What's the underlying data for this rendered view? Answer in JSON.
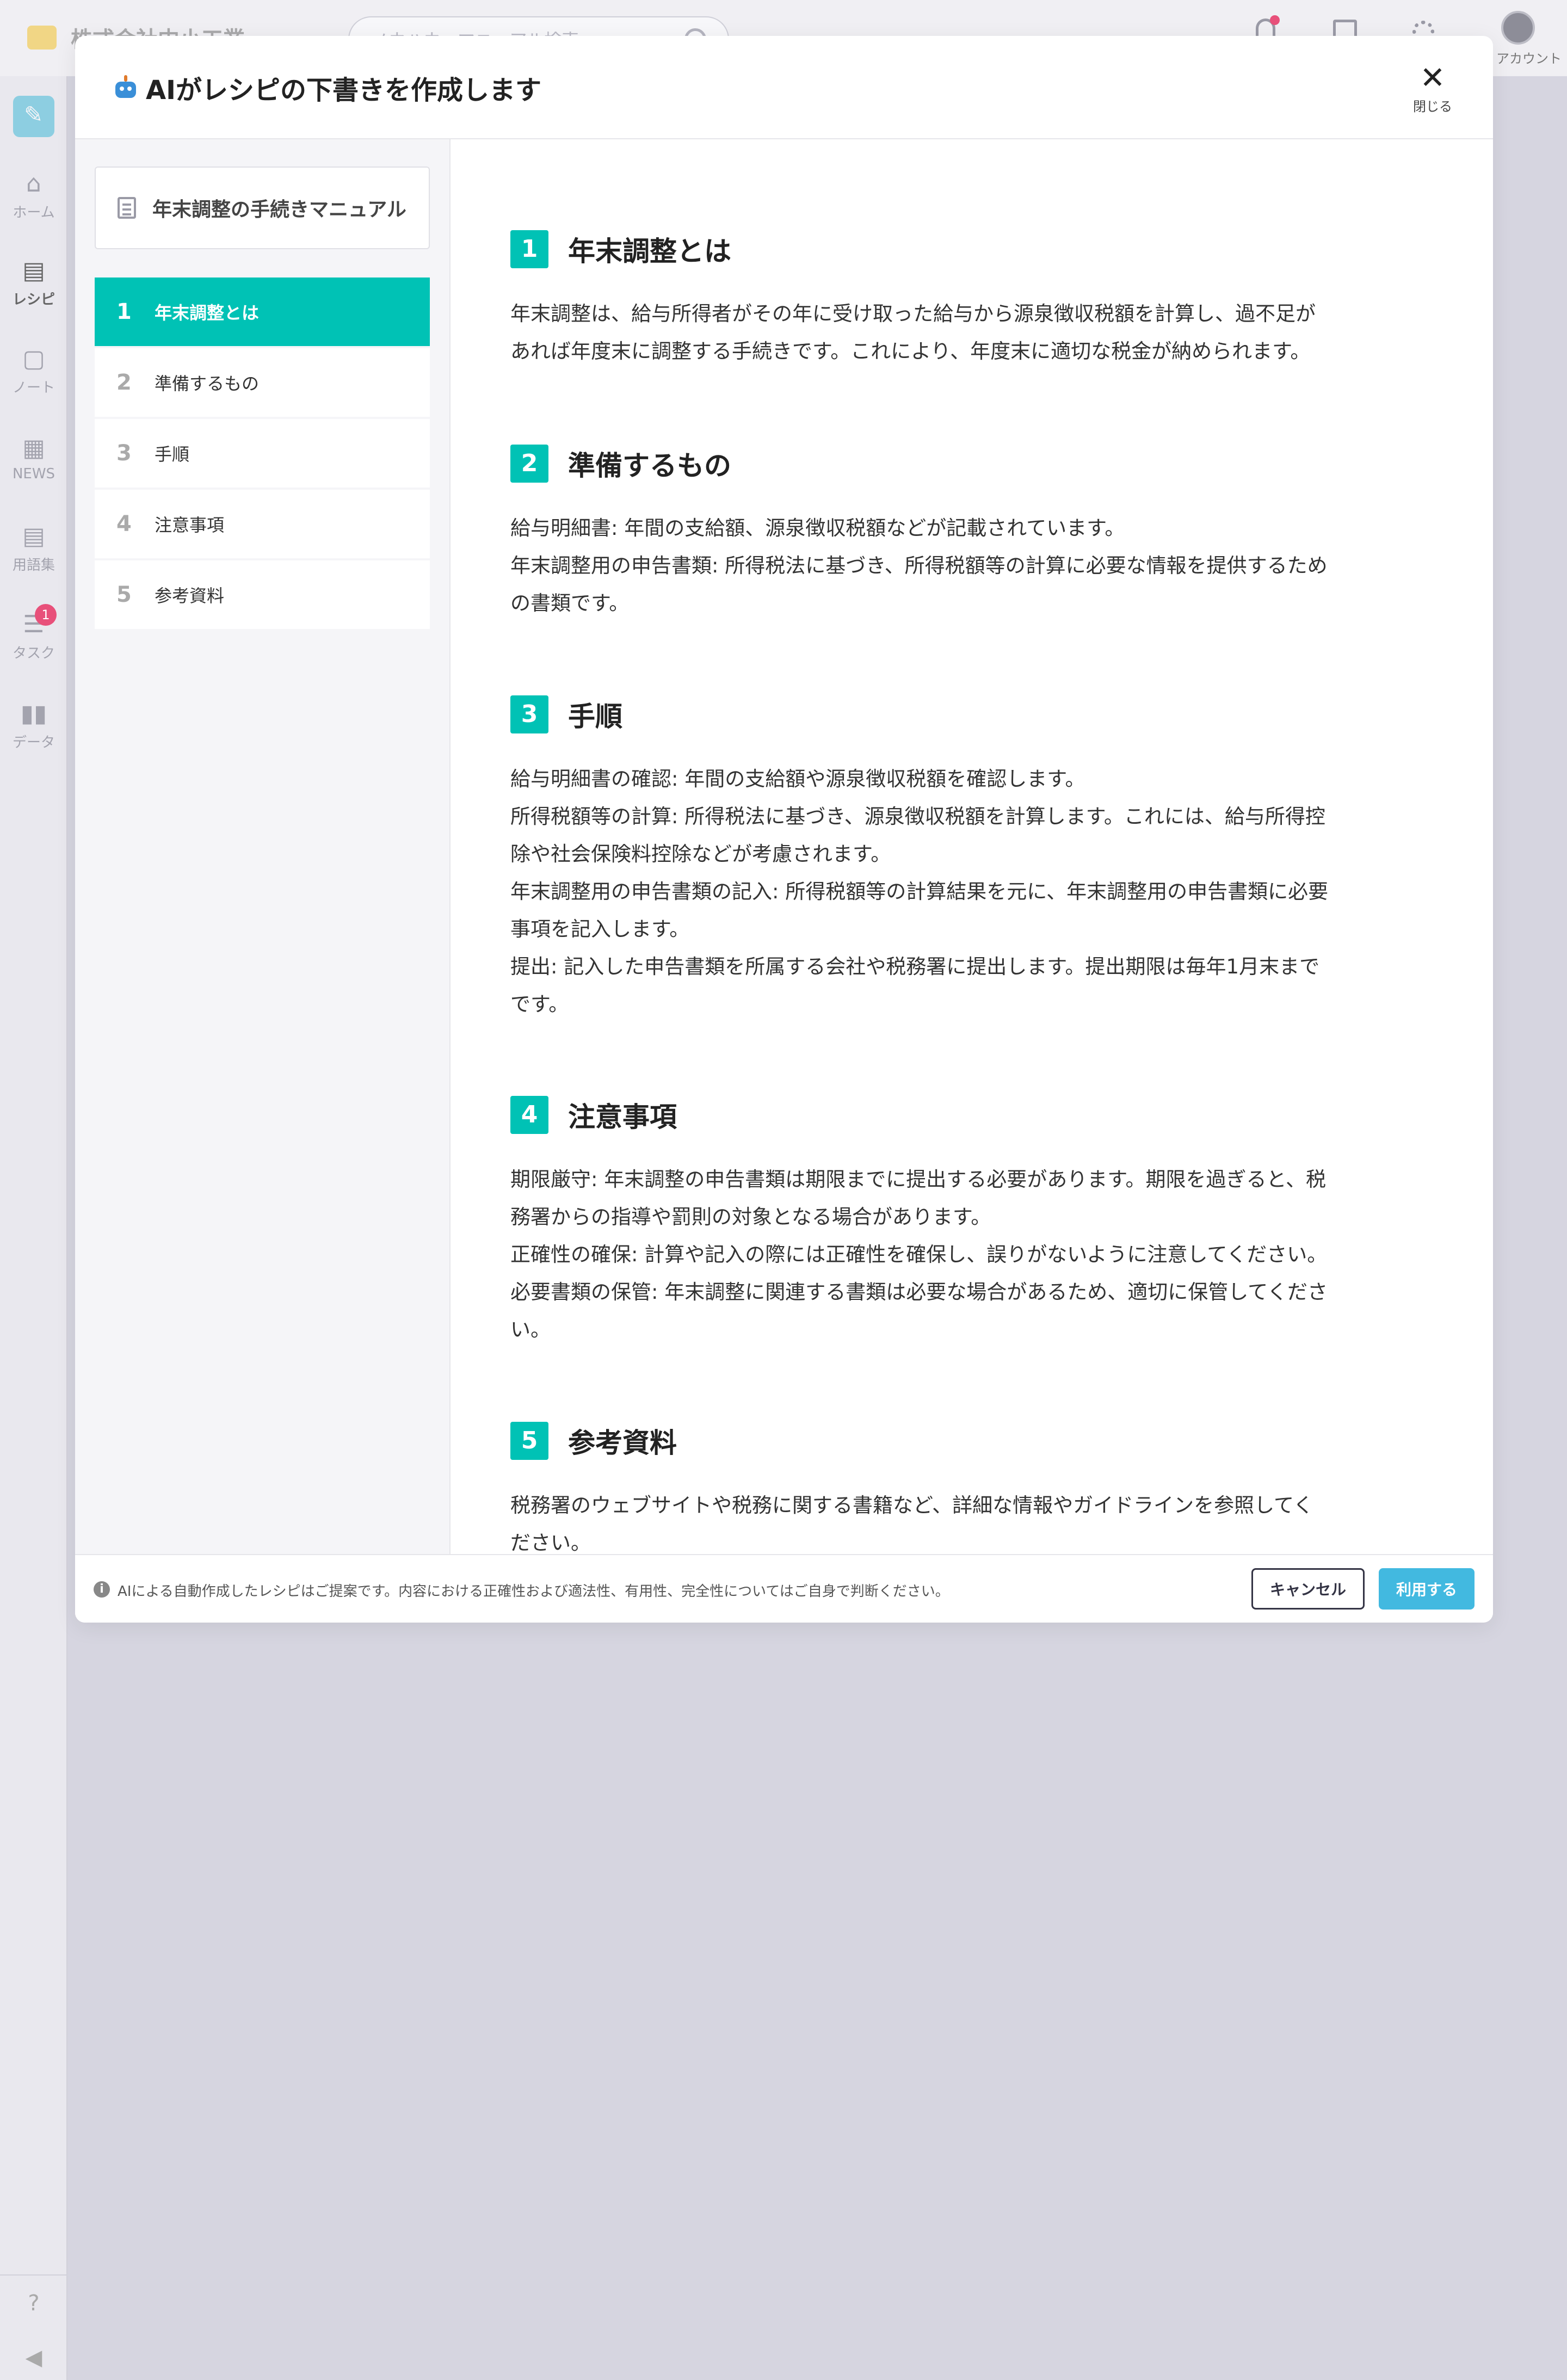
{
  "app": {
    "company": "株式会社中小工業",
    "search_placeholder": "ノウハウ、マニュアル検索",
    "account_label": "アカウント"
  },
  "sidebar": {
    "items": [
      {
        "icon": "home-icon",
        "label": "ホーム"
      },
      {
        "icon": "recipe-icon",
        "label": "レシピ"
      },
      {
        "icon": "note-icon",
        "label": "ノート"
      },
      {
        "icon": "news-icon",
        "label": "NEWS"
      },
      {
        "icon": "glossary-icon",
        "label": "用語集"
      },
      {
        "icon": "task-icon",
        "label": "タスク",
        "badge": "1"
      },
      {
        "icon": "data-icon",
        "label": "データ"
      }
    ]
  },
  "modal": {
    "title": "AIがレシピの下書きを作成します",
    "close_label": "閉じる",
    "doc_title": "年末調整の手続きマニュアル",
    "toc": [
      {
        "num": "1",
        "label": "年末調整とは"
      },
      {
        "num": "2",
        "label": "準備するもの"
      },
      {
        "num": "3",
        "label": "手順"
      },
      {
        "num": "4",
        "label": "注意事項"
      },
      {
        "num": "5",
        "label": "参考資料"
      }
    ],
    "sections": [
      {
        "num": "1",
        "title": "年末調整とは",
        "lines": [
          "年末調整は、給与所得者がその年に受け取った給与から源泉徴収税額を計算し、過不足が",
          "あれば年度末に調整する手続きです。これにより、年度末に適切な税金が納められます。"
        ]
      },
      {
        "num": "2",
        "title": "準備するもの",
        "lines": [
          "給与明細書: 年間の支給額、源泉徴収税額などが記載されています。",
          "年末調整用の申告書類: 所得税法に基づき、所得税額等の計算に必要な情報を提供するため",
          "の書類です。"
        ]
      },
      {
        "num": "3",
        "title": "手順",
        "lines": [
          "給与明細書の確認: 年間の支給額や源泉徴収税額を確認します。",
          "所得税額等の計算: 所得税法に基づき、源泉徴収税額を計算します。これには、給与所得控",
          "除や社会保険料控除などが考慮されます。",
          "年末調整用の申告書類の記入: 所得税額等の計算結果を元に、年末調整用の申告書類に必要",
          "事項を記入します。",
          "提出: 記入した申告書類を所属する会社や税務署に提出します。提出期限は毎年1月末まで",
          "です。"
        ]
      },
      {
        "num": "4",
        "title": "注意事項",
        "lines": [
          "期限厳守: 年末調整の申告書類は期限までに提出する必要があります。期限を過ぎると、税",
          "務署からの指導や罰則の対象となる場合があります。",
          "正確性の確保: 計算や記入の際には正確性を確保し、誤りがないように注意してください。",
          "必要書類の保管: 年末調整に関連する書類は必要な場合があるため、適切に保管してくださ",
          "い。"
        ]
      },
      {
        "num": "5",
        "title": "参考資料",
        "lines": [
          "税務署のウェブサイトや税務に関する書籍など、詳細な情報やガイドラインを参照してく",
          "ださい。"
        ]
      }
    ],
    "disclaimer": "AIによる自動作成したレシピはご提案です。内容における正確性および適法性、有用性、完全性についてはご自身で判断ください。",
    "cancel_label": "キャンセル",
    "use_label": "利用する"
  },
  "colors": {
    "accent": "#00c2b5",
    "primary_button": "#42b9e0",
    "badge": "#e8507a"
  }
}
